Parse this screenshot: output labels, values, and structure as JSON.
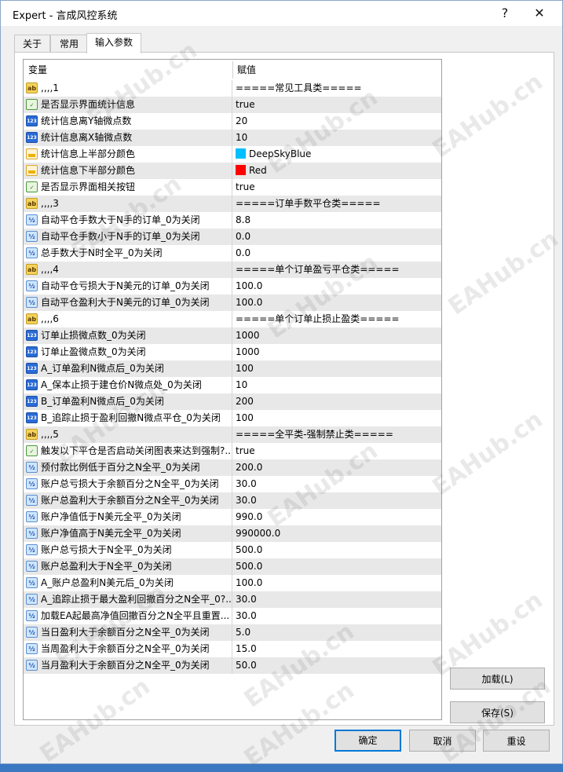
{
  "window": {
    "title": "Expert - 言成风控系统",
    "help": "?",
    "close": "✕"
  },
  "tabs": [
    "关于",
    "常用",
    "输入参数"
  ],
  "grid": {
    "headers": [
      "变量",
      "赋值"
    ],
    "rows": [
      {
        "icon": "ab",
        "name": ",,,,1",
        "value": "=====常见工具类====="
      },
      {
        "icon": "bool",
        "name": "是否显示界面统计信息",
        "value": "true"
      },
      {
        "icon": "int",
        "name": "统计信息离Y轴微点数",
        "value": "20"
      },
      {
        "icon": "int",
        "name": "统计信息离X轴微点数",
        "value": "10"
      },
      {
        "icon": "color",
        "name": "统计信息上半部分颜色",
        "value": "DeepSkyBlue",
        "swatch": "#00bfff"
      },
      {
        "icon": "color",
        "name": "统计信息下半部分颜色",
        "value": "Red",
        "swatch": "#ff0000"
      },
      {
        "icon": "bool",
        "name": "是否显示界面相关按钮",
        "value": "true"
      },
      {
        "icon": "ab",
        "name": ",,,,3",
        "value": "=====订单手数平仓类====="
      },
      {
        "icon": "dbl",
        "name": "自动平仓手数大于N手的订单_0为关闭",
        "value": "8.8"
      },
      {
        "icon": "dbl",
        "name": "自动平仓手数小于N手的订单_0为关闭",
        "value": "0.0"
      },
      {
        "icon": "dbl",
        "name": "总手数大于N时全平_0为关闭",
        "value": "0.0"
      },
      {
        "icon": "ab",
        "name": ",,,,4",
        "value": "=====单个订单盈亏平仓类====="
      },
      {
        "icon": "dbl",
        "name": "自动平仓亏损大于N美元的订单_0为关闭",
        "value": "100.0"
      },
      {
        "icon": "dbl",
        "name": "自动平仓盈利大于N美元的订单_0为关闭",
        "value": "100.0"
      },
      {
        "icon": "ab",
        "name": ",,,,6",
        "value": "=====单个订单止损止盈类====="
      },
      {
        "icon": "int",
        "name": "订单止损微点数_0为关闭",
        "value": "1000"
      },
      {
        "icon": "int",
        "name": "订单止盈微点数_0为关闭",
        "value": "1000"
      },
      {
        "icon": "int",
        "name": "A_订单盈利N微点后_0为关闭",
        "value": "100"
      },
      {
        "icon": "int",
        "name": "A_保本止损于建仓价N微点处_0为关闭",
        "value": "10"
      },
      {
        "icon": "int",
        "name": "B_订单盈利N微点后_0为关闭",
        "value": "200"
      },
      {
        "icon": "int",
        "name": "B_追踪止损于盈利回撤N微点平仓_0为关闭",
        "value": "100"
      },
      {
        "icon": "ab",
        "name": ",,,,5",
        "value": "=====全平类-强制禁止类====="
      },
      {
        "icon": "bool",
        "name": "触发以下平仓是否启动关闭图表来达到强制?..",
        "value": "true"
      },
      {
        "icon": "dbl",
        "name": "预付款比例低于百分之N全平_0为关闭",
        "value": "200.0"
      },
      {
        "icon": "dbl",
        "name": "账户总亏损大于余额百分之N全平_0为关闭",
        "value": "30.0"
      },
      {
        "icon": "dbl",
        "name": "账户总盈利大于余额百分之N全平_0为关闭",
        "value": "30.0"
      },
      {
        "icon": "dbl",
        "name": "账户净值低于N美元全平_0为关闭",
        "value": "990.0"
      },
      {
        "icon": "dbl",
        "name": "账户净值高于N美元全平_0为关闭",
        "value": "990000.0"
      },
      {
        "icon": "dbl",
        "name": "账户总亏损大于N全平_0为关闭",
        "value": "500.0"
      },
      {
        "icon": "dbl",
        "name": "账户总盈利大于N全平_0为关闭",
        "value": "500.0"
      },
      {
        "icon": "dbl",
        "name": "A_账户总盈利N美元后_0为关闭",
        "value": "100.0"
      },
      {
        "icon": "dbl",
        "name": "A_追踪止损于最大盈利回撤百分之N全平_0?..",
        "value": "30.0"
      },
      {
        "icon": "dbl",
        "name": "加载EA起最高净值回撤百分之N全平且重置...",
        "value": "30.0"
      },
      {
        "icon": "dbl",
        "name": "当日盈利大于余额百分之N全平_0为关闭",
        "value": "5.0"
      },
      {
        "icon": "dbl",
        "name": "当周盈利大于余额百分之N全平_0为关闭",
        "value": "15.0"
      },
      {
        "icon": "dbl",
        "name": "当月盈利大于余额百分之N全平_0为关闭",
        "value": "50.0"
      }
    ]
  },
  "buttons": {
    "load": "加载(L)",
    "save": "保存(S)",
    "ok": "确定",
    "cancel": "取消",
    "reset": "重设"
  },
  "watermark": "EAHub.cn"
}
